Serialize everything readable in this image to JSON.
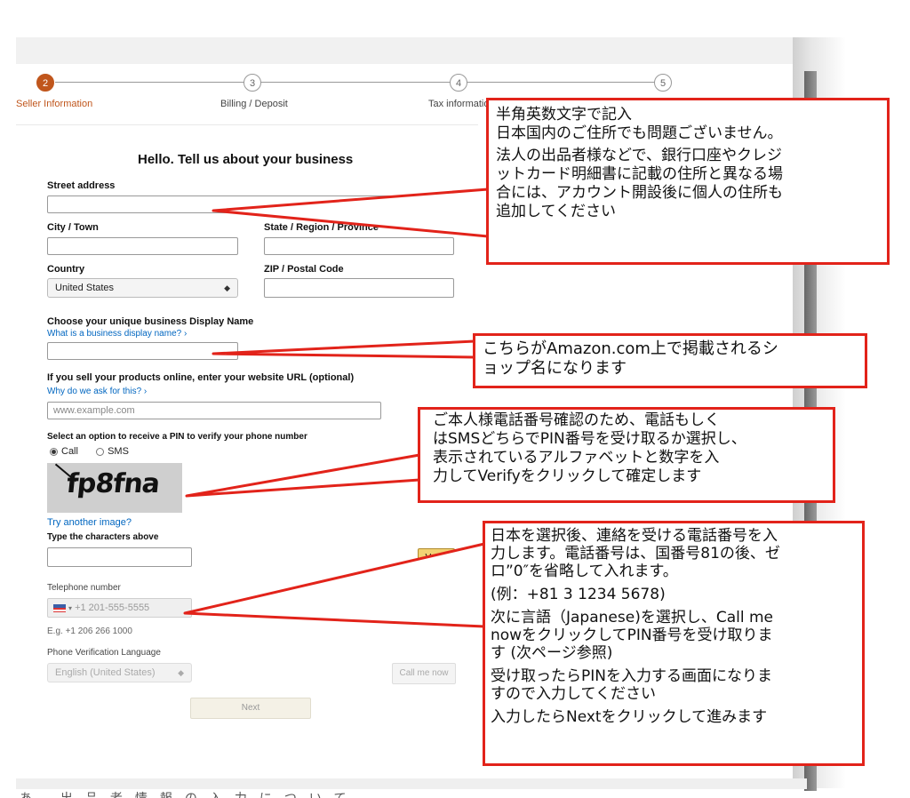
{
  "progress": {
    "steps": [
      {
        "number": "2",
        "label": "Seller Information",
        "active": true
      },
      {
        "number": "3",
        "label": "Billing / Deposit",
        "active": false
      },
      {
        "number": "4",
        "label": "Tax information",
        "active": false
      },
      {
        "number": "5",
        "label": "",
        "active": false
      }
    ]
  },
  "form": {
    "heading": "Hello. Tell us about your business",
    "street_label": "Street address",
    "city_label": "City / Town",
    "state_label": "State / Region / Province",
    "country_label": "Country",
    "country_value": "United States",
    "zip_label": "ZIP / Postal Code",
    "display_name_label": "Choose your unique business Display Name",
    "display_name_help": "What is a business display name? ›",
    "website_label": "If you sell your products online, enter your website URL (optional)",
    "website_help": "Why do we ask for this? ›",
    "website_placeholder": "www.example.com",
    "pin_label": "Select an option to receive a PIN to verify your phone number",
    "pin_options": [
      "Call",
      "SMS"
    ],
    "captcha_text": "fp8fna",
    "try_another": "Try another image?",
    "type_chars_label": "Type the characters above",
    "verify_button": "Verify",
    "telephone_label": "Telephone number",
    "telephone_placeholder": "+1 201-555-5555",
    "telephone_example": "E.g. +1 206 266 1000",
    "phone_lang_label": "Phone Verification Language",
    "phone_lang_value": "English (United States)",
    "call_me_button": "Call me now",
    "next_button": "Next"
  },
  "callouts": {
    "address": [
      "半角英数文字で記入",
      "日本国内のご住所でも問題ございません。",
      "法人の出品者様などで、銀行口座やクレジ",
      "ットカード明細書に記載の住所と異なる場",
      "合には、アカウント開設後に個人の住所も",
      "追加してください"
    ],
    "display_name": [
      "こちらがAmazon.com上で掲載されるシ",
      "ョップ名になります"
    ],
    "pin": [
      "ご本人様電話番号確認のため、電話もしく",
      "はSMSどちらでPIN番号を受け取るか選択し、",
      "表示されているアルファベットと数字を入",
      "力してVerifyをクリックして確定します"
    ],
    "telephone": [
      "日本を選択後、連絡を受ける電話番号を入",
      "力します。電話番号は、国番号81の後、ゼ",
      "ロ”0″を省略して入れます。",
      "(例：+81 3 1234 5678)",
      "次に言語（Japanese)を選択し、Call me",
      "nowをクリックしてPIN番号を受け取りま",
      "す (次ページ参照)",
      "受け取ったらPINを入力する画面になりま",
      "すので入力してください",
      "入力したらNextをクリックして進みます"
    ]
  },
  "bottom_text": "あ 出品者情報の入力について"
}
